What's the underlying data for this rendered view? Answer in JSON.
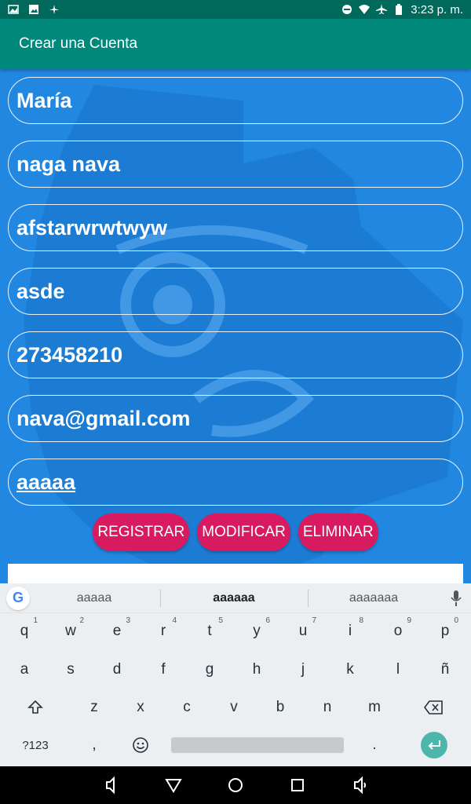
{
  "status_bar": {
    "time": "3:23 p. m."
  },
  "app_bar": {
    "title": "Crear una Cuenta"
  },
  "form": {
    "fields": [
      "María",
      "naga nava",
      "afstarwrwtwyw",
      "asde",
      "273458210",
      "nava@gmail.com",
      "aaaaa"
    ]
  },
  "buttons": {
    "registrar": "REGISTRAR",
    "modificar": "MODIFICAR",
    "eliminar": "ELIMINAR"
  },
  "keyboard": {
    "suggestions": [
      "aaaaa",
      "aaaaaa",
      "aaaaaaa"
    ],
    "row1": [
      "q",
      "w",
      "e",
      "r",
      "t",
      "y",
      "u",
      "i",
      "o",
      "p"
    ],
    "row1_hints": [
      "1",
      "2",
      "3",
      "4",
      "5",
      "6",
      "7",
      "8",
      "9",
      "0"
    ],
    "row2": [
      "a",
      "s",
      "d",
      "f",
      "g",
      "h",
      "j",
      "k",
      "l",
      "ñ"
    ],
    "row3": [
      "z",
      "x",
      "c",
      "v",
      "b",
      "n",
      "m"
    ],
    "symbols_key": "?123",
    "comma_key": ",",
    "period_key": ".",
    "colors": {
      "accent": "#4db6ac"
    }
  },
  "colors": {
    "app_bar": "#00897b",
    "status_bar": "#00695c",
    "background": "#2187e0",
    "button": "#d81b60"
  }
}
